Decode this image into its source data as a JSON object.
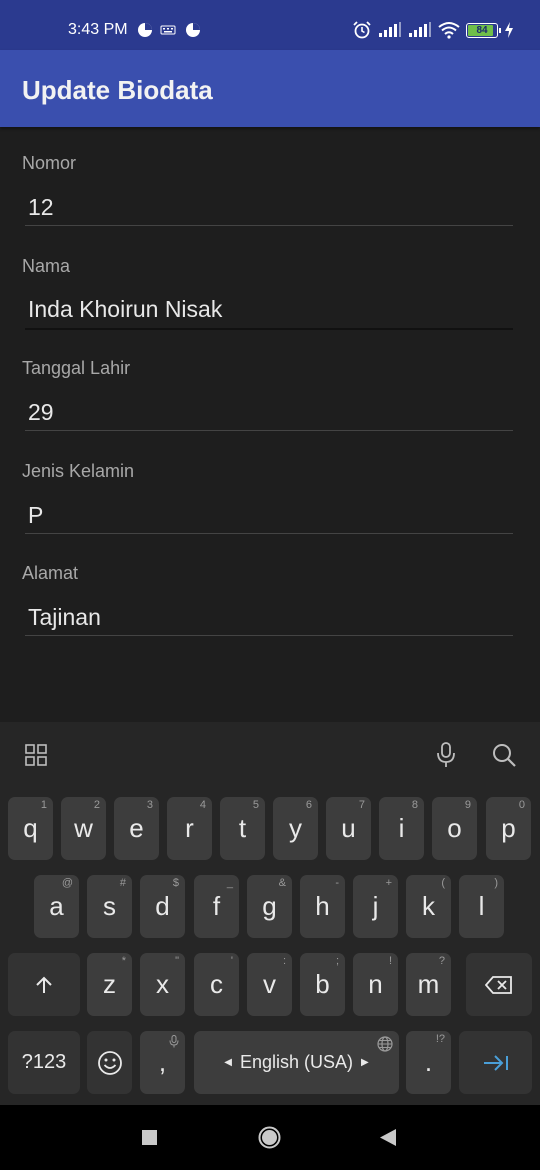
{
  "status_bar": {
    "time": "3:43 PM",
    "battery": "84",
    "icons": [
      "notification-icon",
      "keyboard-icon",
      "notification-icon",
      "alarm-icon",
      "signal-icon",
      "signal-icon",
      "wifi-icon",
      "battery-icon",
      "charging-icon"
    ]
  },
  "app_bar": {
    "title": "Update Biodata",
    "color": "#3a4fae"
  },
  "form": {
    "fields": [
      {
        "label": "Nomor",
        "value": "12"
      },
      {
        "label": "Nama",
        "value": "Inda Khoirun Nisak"
      },
      {
        "label": "Tanggal Lahir",
        "value": "29"
      },
      {
        "label": "Jenis Kelamin",
        "value": "P"
      },
      {
        "label": "Alamat",
        "value": "Tajinan"
      }
    ]
  },
  "keyboard": {
    "row1": [
      {
        "k": "q",
        "h": "1"
      },
      {
        "k": "w",
        "h": "2"
      },
      {
        "k": "e",
        "h": "3"
      },
      {
        "k": "r",
        "h": "4"
      },
      {
        "k": "t",
        "h": "5"
      },
      {
        "k": "y",
        "h": "6"
      },
      {
        "k": "u",
        "h": "7"
      },
      {
        "k": "i",
        "h": "8"
      },
      {
        "k": "o",
        "h": "9"
      },
      {
        "k": "p",
        "h": "0"
      }
    ],
    "row2": [
      {
        "k": "a",
        "h": "@"
      },
      {
        "k": "s",
        "h": "#"
      },
      {
        "k": "d",
        "h": "$"
      },
      {
        "k": "f",
        "h": "_"
      },
      {
        "k": "g",
        "h": "&"
      },
      {
        "k": "h",
        "h": "-"
      },
      {
        "k": "j",
        "h": "+"
      },
      {
        "k": "k",
        "h": "("
      },
      {
        "k": "l",
        "h": ")"
      }
    ],
    "row3": [
      {
        "k": "z",
        "h": "*"
      },
      {
        "k": "x",
        "h": "\""
      },
      {
        "k": "c",
        "h": "'"
      },
      {
        "k": "v",
        "h": ":"
      },
      {
        "k": "b",
        "h": ";"
      },
      {
        "k": "n",
        "h": "!"
      },
      {
        "k": "m",
        "h": "?"
      }
    ],
    "symbols_key": "?123",
    "comma_key": ",",
    "space_key": "English (USA)",
    "period_key": ".",
    "period_hint": "!?",
    "accent_color": "#4a9fd8"
  }
}
